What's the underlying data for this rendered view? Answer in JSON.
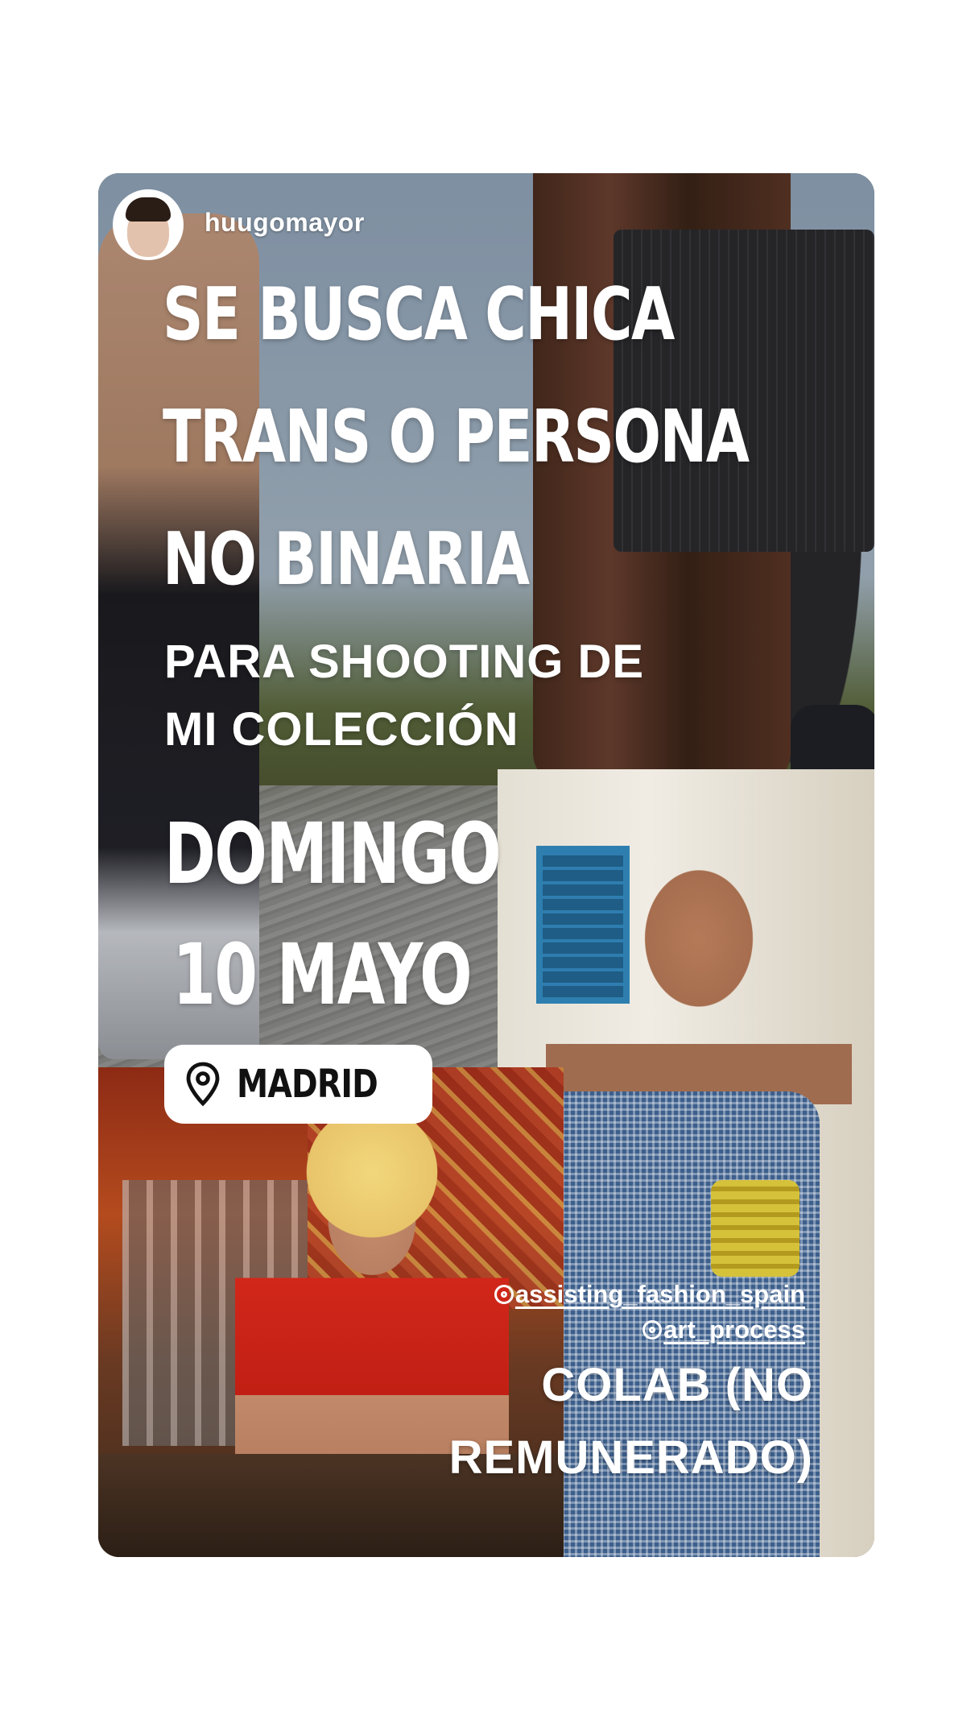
{
  "story": {
    "username": "huugomayor",
    "headline_lines": [
      "SE BUSCA CHICA",
      "TRANS O PERSONA",
      "NO BINARIA"
    ],
    "subhead_lines": [
      "PARA SHOOTING DE",
      "MI COLECCIÓN"
    ],
    "date_lines": [
      "DOMINGO",
      "10 MAYO"
    ],
    "location": {
      "icon": "map-pin-icon",
      "label": "MADRID"
    },
    "mentions": [
      "assisting_fashion_spain",
      "art_process"
    ],
    "colab_lines": [
      "COLAB (NO",
      "REMUNERADO)"
    ]
  }
}
